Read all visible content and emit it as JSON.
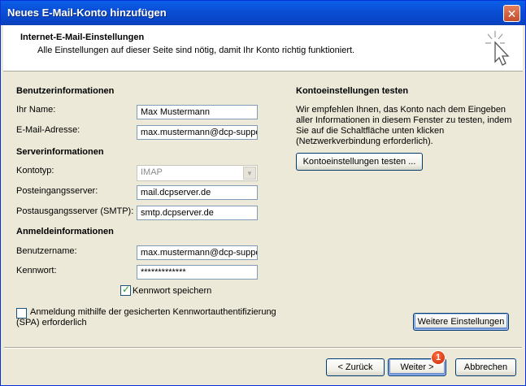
{
  "window": {
    "title": "Neues E-Mail-Konto hinzufügen"
  },
  "header": {
    "title": "Internet-E-Mail-Einstellungen",
    "subtitle": "Alle Einstellungen auf dieser Seite sind nötig, damit Ihr Konto richtig funktioniert."
  },
  "sections": {
    "user_info": "Benutzerinformationen",
    "server_info": "Serverinformationen",
    "login_info": "Anmeldeinformationen",
    "test": "Kontoeinstellungen testen"
  },
  "fields": {
    "name": {
      "label": "Ihr Name:",
      "value": "Max Mustermann"
    },
    "email": {
      "label": "E-Mail-Adresse:",
      "value": "max.mustermann@dcp-suppo"
    },
    "account_type": {
      "label": "Kontotyp:",
      "value": "IMAP"
    },
    "incoming": {
      "label": "Posteingangsserver:",
      "value": "mail.dcpserver.de"
    },
    "outgoing": {
      "label": "Postausgangsserver (SMTP):",
      "value": "smtp.dcpserver.de"
    },
    "username": {
      "label": "Benutzername:",
      "value": "max.mustermann@dcp-suppo"
    },
    "password": {
      "label": "Kennwort:",
      "value": "*************"
    }
  },
  "checkboxes": {
    "save_password": {
      "label": "Kennwort speichern",
      "checked": true
    },
    "spa": {
      "label_line1": "Anmeldung mithilfe der gesicherten Kennwortauthentifizierung",
      "label_line2": "(SPA) erforderlich",
      "checked": false
    }
  },
  "test_text": "Wir empfehlen Ihnen, das Konto nach dem Eingeben aller Informationen in diesem Fenster zu testen, indem Sie auf die Schaltfläche unten klicken (Netzwerkverbindung erforderlich).",
  "buttons": {
    "test": "Kontoeinstellungen testen ...",
    "more": "Weitere Einstellungen",
    "back": "< Zurück",
    "next": "Weiter >",
    "cancel": "Abbrechen"
  },
  "badge": "1",
  "icons": {
    "close": "close-icon",
    "header": "cursor-sparkle-icon",
    "dropdown": "chevron-down-icon",
    "check": "checkmark-icon"
  }
}
